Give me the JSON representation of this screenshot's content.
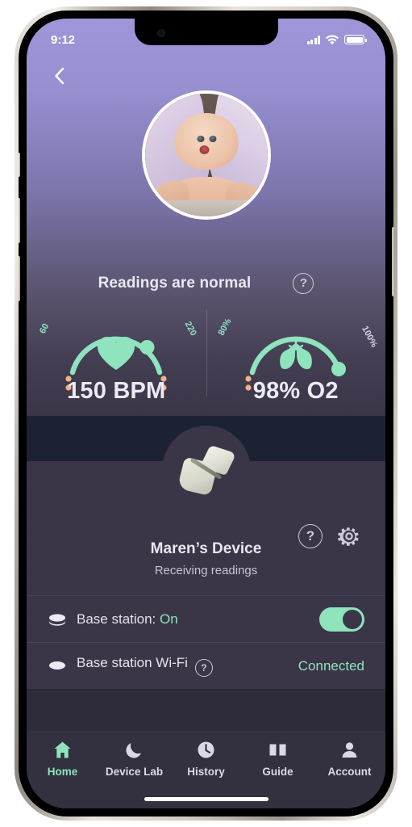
{
  "status_bar": {
    "time": "9:12",
    "signal_icon": "cellular-signal-icon",
    "wifi_icon": "wifi-icon",
    "battery_icon": "battery-full-icon"
  },
  "header": {
    "back_icon": "chevron-left-icon",
    "avatar_alt": "baby-avatar",
    "status_text": "Readings are normal",
    "help_label": "?"
  },
  "gauges": [
    {
      "name": "heart-rate",
      "icon": "heart-icon",
      "min_label": "60",
      "max_label": "220",
      "value_text": "150 BPM",
      "value": 150,
      "min": 60,
      "max": 220,
      "arc_color": "#8fe3bd",
      "tick_color": "#f0b08a",
      "min_label_color": "#8fe3bd",
      "max_label_color": "#8fe3bd"
    },
    {
      "name": "oxygen",
      "icon": "lungs-icon",
      "min_label": "80%",
      "max_label": "100%",
      "value_text": "98% O2",
      "value": 98,
      "min": 80,
      "max": 100,
      "arc_color": "#8fe3bd",
      "tick_color": "#f0b08a",
      "min_label_color": "#8fe3bd",
      "max_label_color": "#d8d5e4"
    }
  ],
  "device": {
    "image_alt": "baby-sock-device",
    "help_label": "?",
    "gear_icon": "gear-icon",
    "name": "Maren’s Device",
    "subtitle": "Receiving readings"
  },
  "rows": [
    {
      "icon": "base-station-icon",
      "label": "Base station: ",
      "value": "On",
      "control": "toggle",
      "toggle_on": true,
      "help": null
    },
    {
      "icon": "base-station-icon",
      "label": "Base station Wi-Fi",
      "value": "Connected",
      "control": "status",
      "help": "?"
    }
  ],
  "tabs": [
    {
      "label": "Home",
      "icon": "home-icon",
      "active": true
    },
    {
      "label": "Device Lab",
      "icon": "moon-icon",
      "active": false
    },
    {
      "label": "History",
      "icon": "clock-icon",
      "active": false
    },
    {
      "label": "Guide",
      "icon": "book-icon",
      "active": false
    },
    {
      "label": "Account",
      "icon": "person-icon",
      "active": false
    }
  ],
  "colors": {
    "accent": "#8fe3bd",
    "tick": "#f0b08a",
    "surface": "#3a3547",
    "band": "#1d2233",
    "tabbar": "#33303f"
  }
}
